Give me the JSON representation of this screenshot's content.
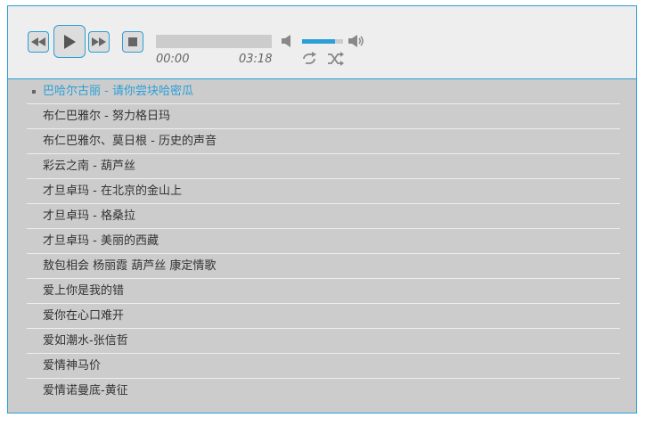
{
  "player": {
    "time_current": "00:00",
    "time_duration": "03:18",
    "progress": 0,
    "volume": 0.8,
    "colors": {
      "accent": "#2a9fd8",
      "panel": "#eeeeee",
      "list_bg": "#cccccc",
      "text": "#333333"
    }
  },
  "controls": {
    "rewind_icon": "rewind-icon",
    "play_icon": "play-icon",
    "fast_forward_icon": "fast-forward-icon",
    "stop_icon": "stop-icon",
    "mute_icon": "volume-mute-icon",
    "volume_max_icon": "volume-max-icon",
    "repeat_icon": "repeat-icon",
    "shuffle_icon": "shuffle-icon"
  },
  "playlist": {
    "current_index": 0,
    "tracks": [
      "巴哈尔古丽 - 请你尝块哈密瓜",
      "布仁巴雅尔 - 努力格日玛",
      "布仁巴雅尔、莫日根 - 历史的声音",
      "彩云之南 - 葫芦丝",
      "才旦卓玛 - 在北京的金山上",
      "才旦卓玛 - 格桑拉",
      "才旦卓玛 - 美丽的西藏",
      "敖包相会 杨丽霞 葫芦丝 康定情歌",
      "爱上你是我的错",
      "爱你在心口难开",
      "爱如潮水-张信哲",
      "爱情神马价",
      "爱情诺曼底-黄征"
    ]
  }
}
